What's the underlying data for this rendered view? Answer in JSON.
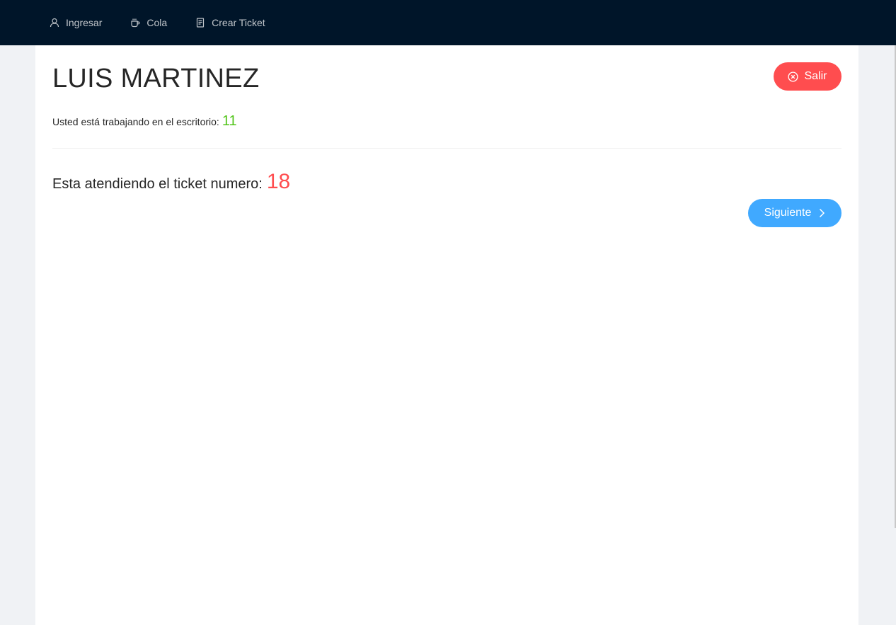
{
  "nav": {
    "items": [
      {
        "label": "Ingresar",
        "icon": "user-icon"
      },
      {
        "label": "Cola",
        "icon": "cup-icon"
      },
      {
        "label": "Crear Ticket",
        "icon": "file-text-icon"
      }
    ]
  },
  "agent": {
    "name": "LUIS MARTINEZ",
    "exit_label": "Salir",
    "desk_text": "Usted está trabajando en el escritorio:",
    "desk_number": "11"
  },
  "ticket": {
    "text": "Esta atendiendo el ticket numero:",
    "number": "18",
    "next_label": "Siguiente"
  },
  "colors": {
    "header_bg": "#001529",
    "danger": "#ff4d4f",
    "success": "#52c41a",
    "primary": "#40a9ff"
  }
}
